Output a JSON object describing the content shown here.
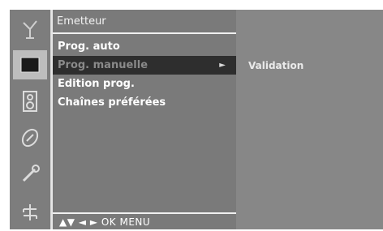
{
  "menu": {
    "header": "Emetteur",
    "items": [
      {
        "label": "Prog. auto"
      },
      {
        "label": "Prog. manuelle",
        "arrow": "►"
      },
      {
        "label": "Edition prog."
      },
      {
        "label": "Chaînes préférées"
      }
    ],
    "footer": "▲▼  ◄ ►  OK  MENU"
  },
  "submenu": {
    "validation": "Validation"
  },
  "icons": [
    "antenna-icon",
    "picture-icon",
    "sound-icon",
    "clock-icon",
    "wrench-icon",
    "input-icon"
  ],
  "colors": {
    "icon_strip": "#7d7d7d",
    "menu_panel": "#7a7a7a",
    "active_row": "#2e2e2e",
    "right_panel": "#878787"
  }
}
